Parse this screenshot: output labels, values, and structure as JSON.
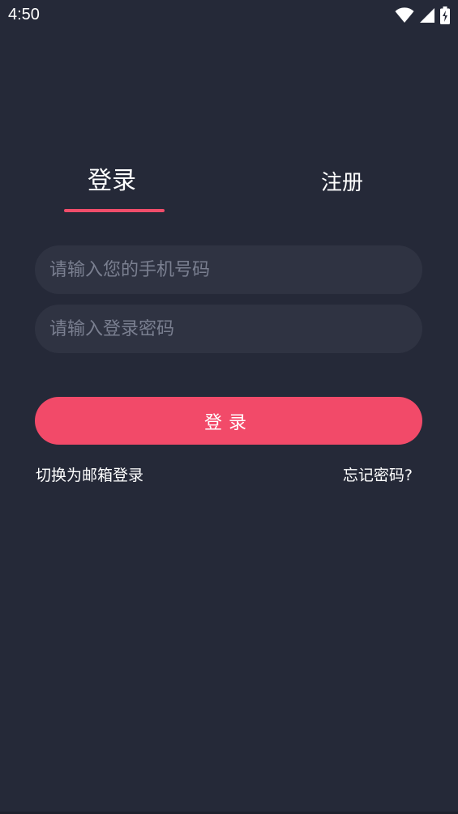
{
  "status_bar": {
    "time": "4:50",
    "icons": [
      "wifi-icon",
      "signal-icon",
      "battery-charging-icon"
    ]
  },
  "tabs": {
    "login_label": "登录",
    "register_label": "注册",
    "active": "login"
  },
  "form": {
    "phone_placeholder": "请输入您的手机号码",
    "phone_value": "",
    "password_placeholder": "请输入登录密码",
    "password_value": "",
    "submit_label": "登录"
  },
  "links": {
    "switch_email": "切换为邮箱登录",
    "forgot_password": "忘记密码?"
  },
  "colors": {
    "background": "#252938",
    "input_background": "#2f3342",
    "accent": "#f24a69",
    "placeholder": "#7a7f90"
  }
}
